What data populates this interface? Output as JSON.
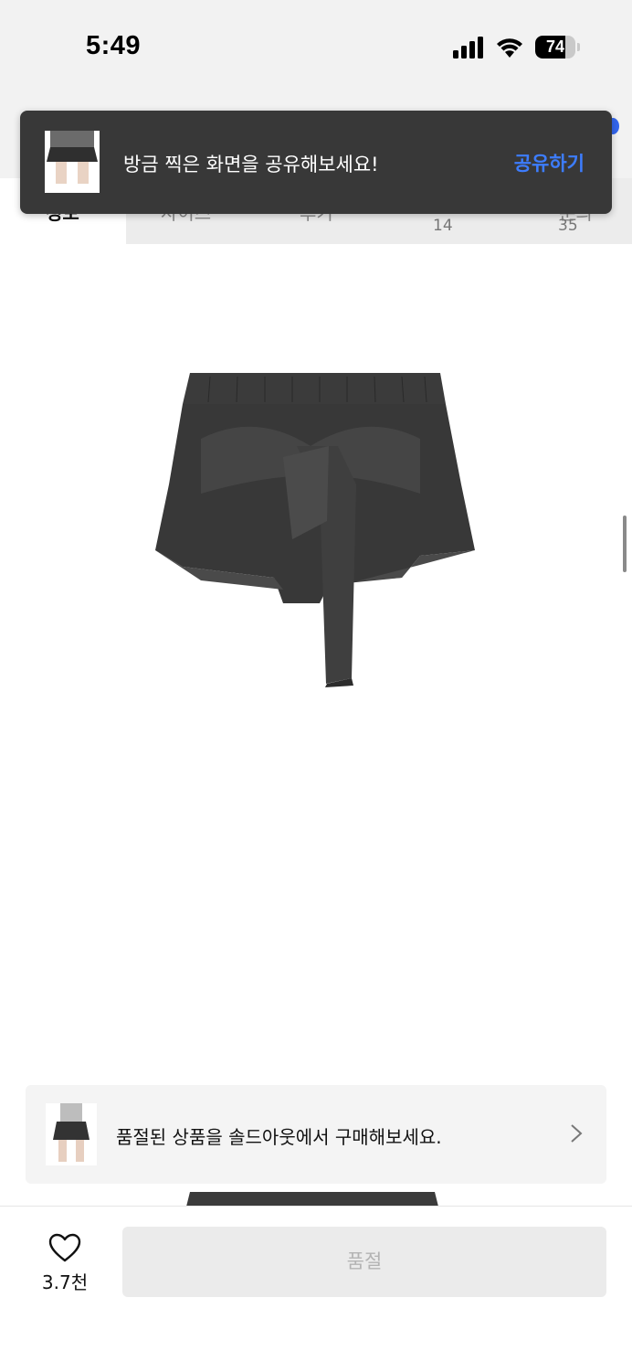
{
  "status_bar": {
    "time": "5:49",
    "battery": "74",
    "battery_level": 0.74
  },
  "tabs": {
    "items": [
      {
        "label": "정보"
      },
      {
        "label": "사이즈"
      },
      {
        "label": "후기",
        "count": "14"
      },
      {
        "label": "문의",
        "count": "35"
      }
    ]
  },
  "toast": {
    "message": "방금 찍은 화면을 공유해보세요!",
    "action": "공유하기"
  },
  "banner": {
    "text": "품절된 상품을 솔드아웃에서 구매해보세요."
  },
  "bottom_bar": {
    "like_count": "3.7천",
    "buy_label": "품절"
  },
  "colors": {
    "accent": "#3d7dff",
    "toast_bg": "#383838",
    "disabled_bg": "#ebebeb"
  },
  "icons": [
    "signal-icon",
    "wifi-icon",
    "battery-icon",
    "chevron-right-icon",
    "heart-icon"
  ]
}
